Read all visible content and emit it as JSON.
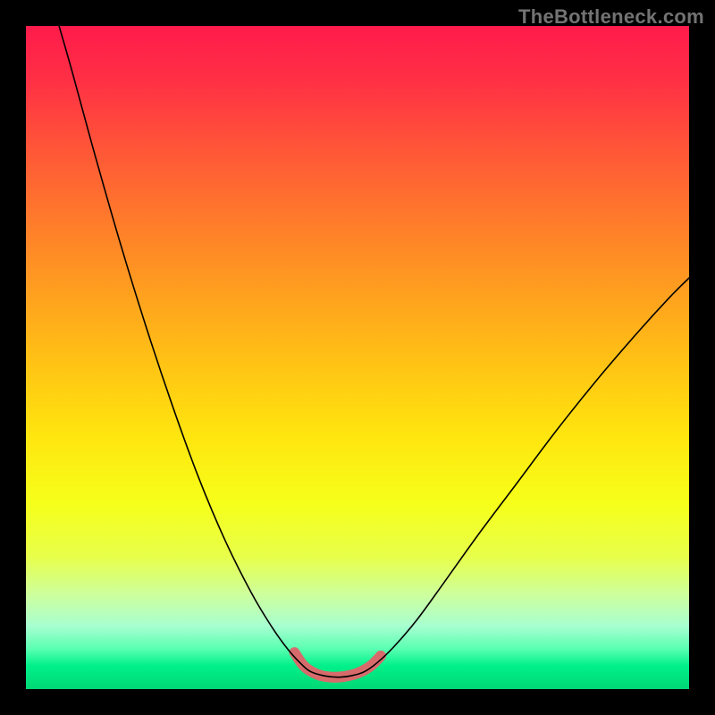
{
  "watermark": "TheBottleneck.com",
  "chart_data": {
    "type": "line",
    "title": "",
    "xlabel": "",
    "ylabel": "",
    "xlim": [
      0,
      100
    ],
    "ylim": [
      0,
      100
    ],
    "background_gradient_stops": [
      {
        "offset": 0.0,
        "color": "#ff1b4b"
      },
      {
        "offset": 0.08,
        "color": "#ff2f45"
      },
      {
        "offset": 0.2,
        "color": "#ff5b36"
      },
      {
        "offset": 0.35,
        "color": "#ff8e24"
      },
      {
        "offset": 0.5,
        "color": "#ffc015"
      },
      {
        "offset": 0.62,
        "color": "#ffe60e"
      },
      {
        "offset": 0.72,
        "color": "#f6ff1a"
      },
      {
        "offset": 0.8,
        "color": "#e8ff4a"
      },
      {
        "offset": 0.86,
        "color": "#ccffa0"
      },
      {
        "offset": 0.905,
        "color": "#a7ffd0"
      },
      {
        "offset": 0.94,
        "color": "#58ffb0"
      },
      {
        "offset": 0.965,
        "color": "#00f08a"
      },
      {
        "offset": 1.0,
        "color": "#00d874"
      }
    ],
    "series": [
      {
        "name": "bottleneck-curve",
        "stroke": "#000000",
        "stroke_width": 1.6,
        "points": [
          {
            "x": 5.0,
            "y": 100.0
          },
          {
            "x": 7.0,
            "y": 93.0
          },
          {
            "x": 10.0,
            "y": 82.0
          },
          {
            "x": 14.0,
            "y": 68.0
          },
          {
            "x": 18.0,
            "y": 55.0
          },
          {
            "x": 22.0,
            "y": 43.0
          },
          {
            "x": 26.0,
            "y": 32.0
          },
          {
            "x": 30.0,
            "y": 22.5
          },
          {
            "x": 34.0,
            "y": 14.5
          },
          {
            "x": 37.0,
            "y": 9.5
          },
          {
            "x": 39.5,
            "y": 6.0
          },
          {
            "x": 41.5,
            "y": 3.8
          },
          {
            "x": 43.0,
            "y": 2.6
          },
          {
            "x": 45.0,
            "y": 2.0
          },
          {
            "x": 47.0,
            "y": 1.8
          },
          {
            "x": 49.0,
            "y": 2.0
          },
          {
            "x": 51.0,
            "y": 2.6
          },
          {
            "x": 53.0,
            "y": 4.0
          },
          {
            "x": 55.5,
            "y": 6.4
          },
          {
            "x": 59.0,
            "y": 10.5
          },
          {
            "x": 63.0,
            "y": 16.0
          },
          {
            "x": 68.0,
            "y": 23.0
          },
          {
            "x": 74.0,
            "y": 31.0
          },
          {
            "x": 80.0,
            "y": 39.0
          },
          {
            "x": 86.0,
            "y": 46.5
          },
          {
            "x": 92.0,
            "y": 53.5
          },
          {
            "x": 97.0,
            "y": 59.0
          },
          {
            "x": 100.0,
            "y": 62.0
          }
        ]
      },
      {
        "name": "optimal-zone-highlight",
        "stroke": "#d76b6b",
        "stroke_width": 12,
        "points": [
          {
            "x": 40.5,
            "y": 5.5
          },
          {
            "x": 42.0,
            "y": 3.4
          },
          {
            "x": 44.0,
            "y": 2.2
          },
          {
            "x": 46.0,
            "y": 1.8
          },
          {
            "x": 48.0,
            "y": 1.9
          },
          {
            "x": 50.0,
            "y": 2.4
          },
          {
            "x": 52.0,
            "y": 3.5
          },
          {
            "x": 53.5,
            "y": 5.0
          }
        ]
      }
    ]
  }
}
